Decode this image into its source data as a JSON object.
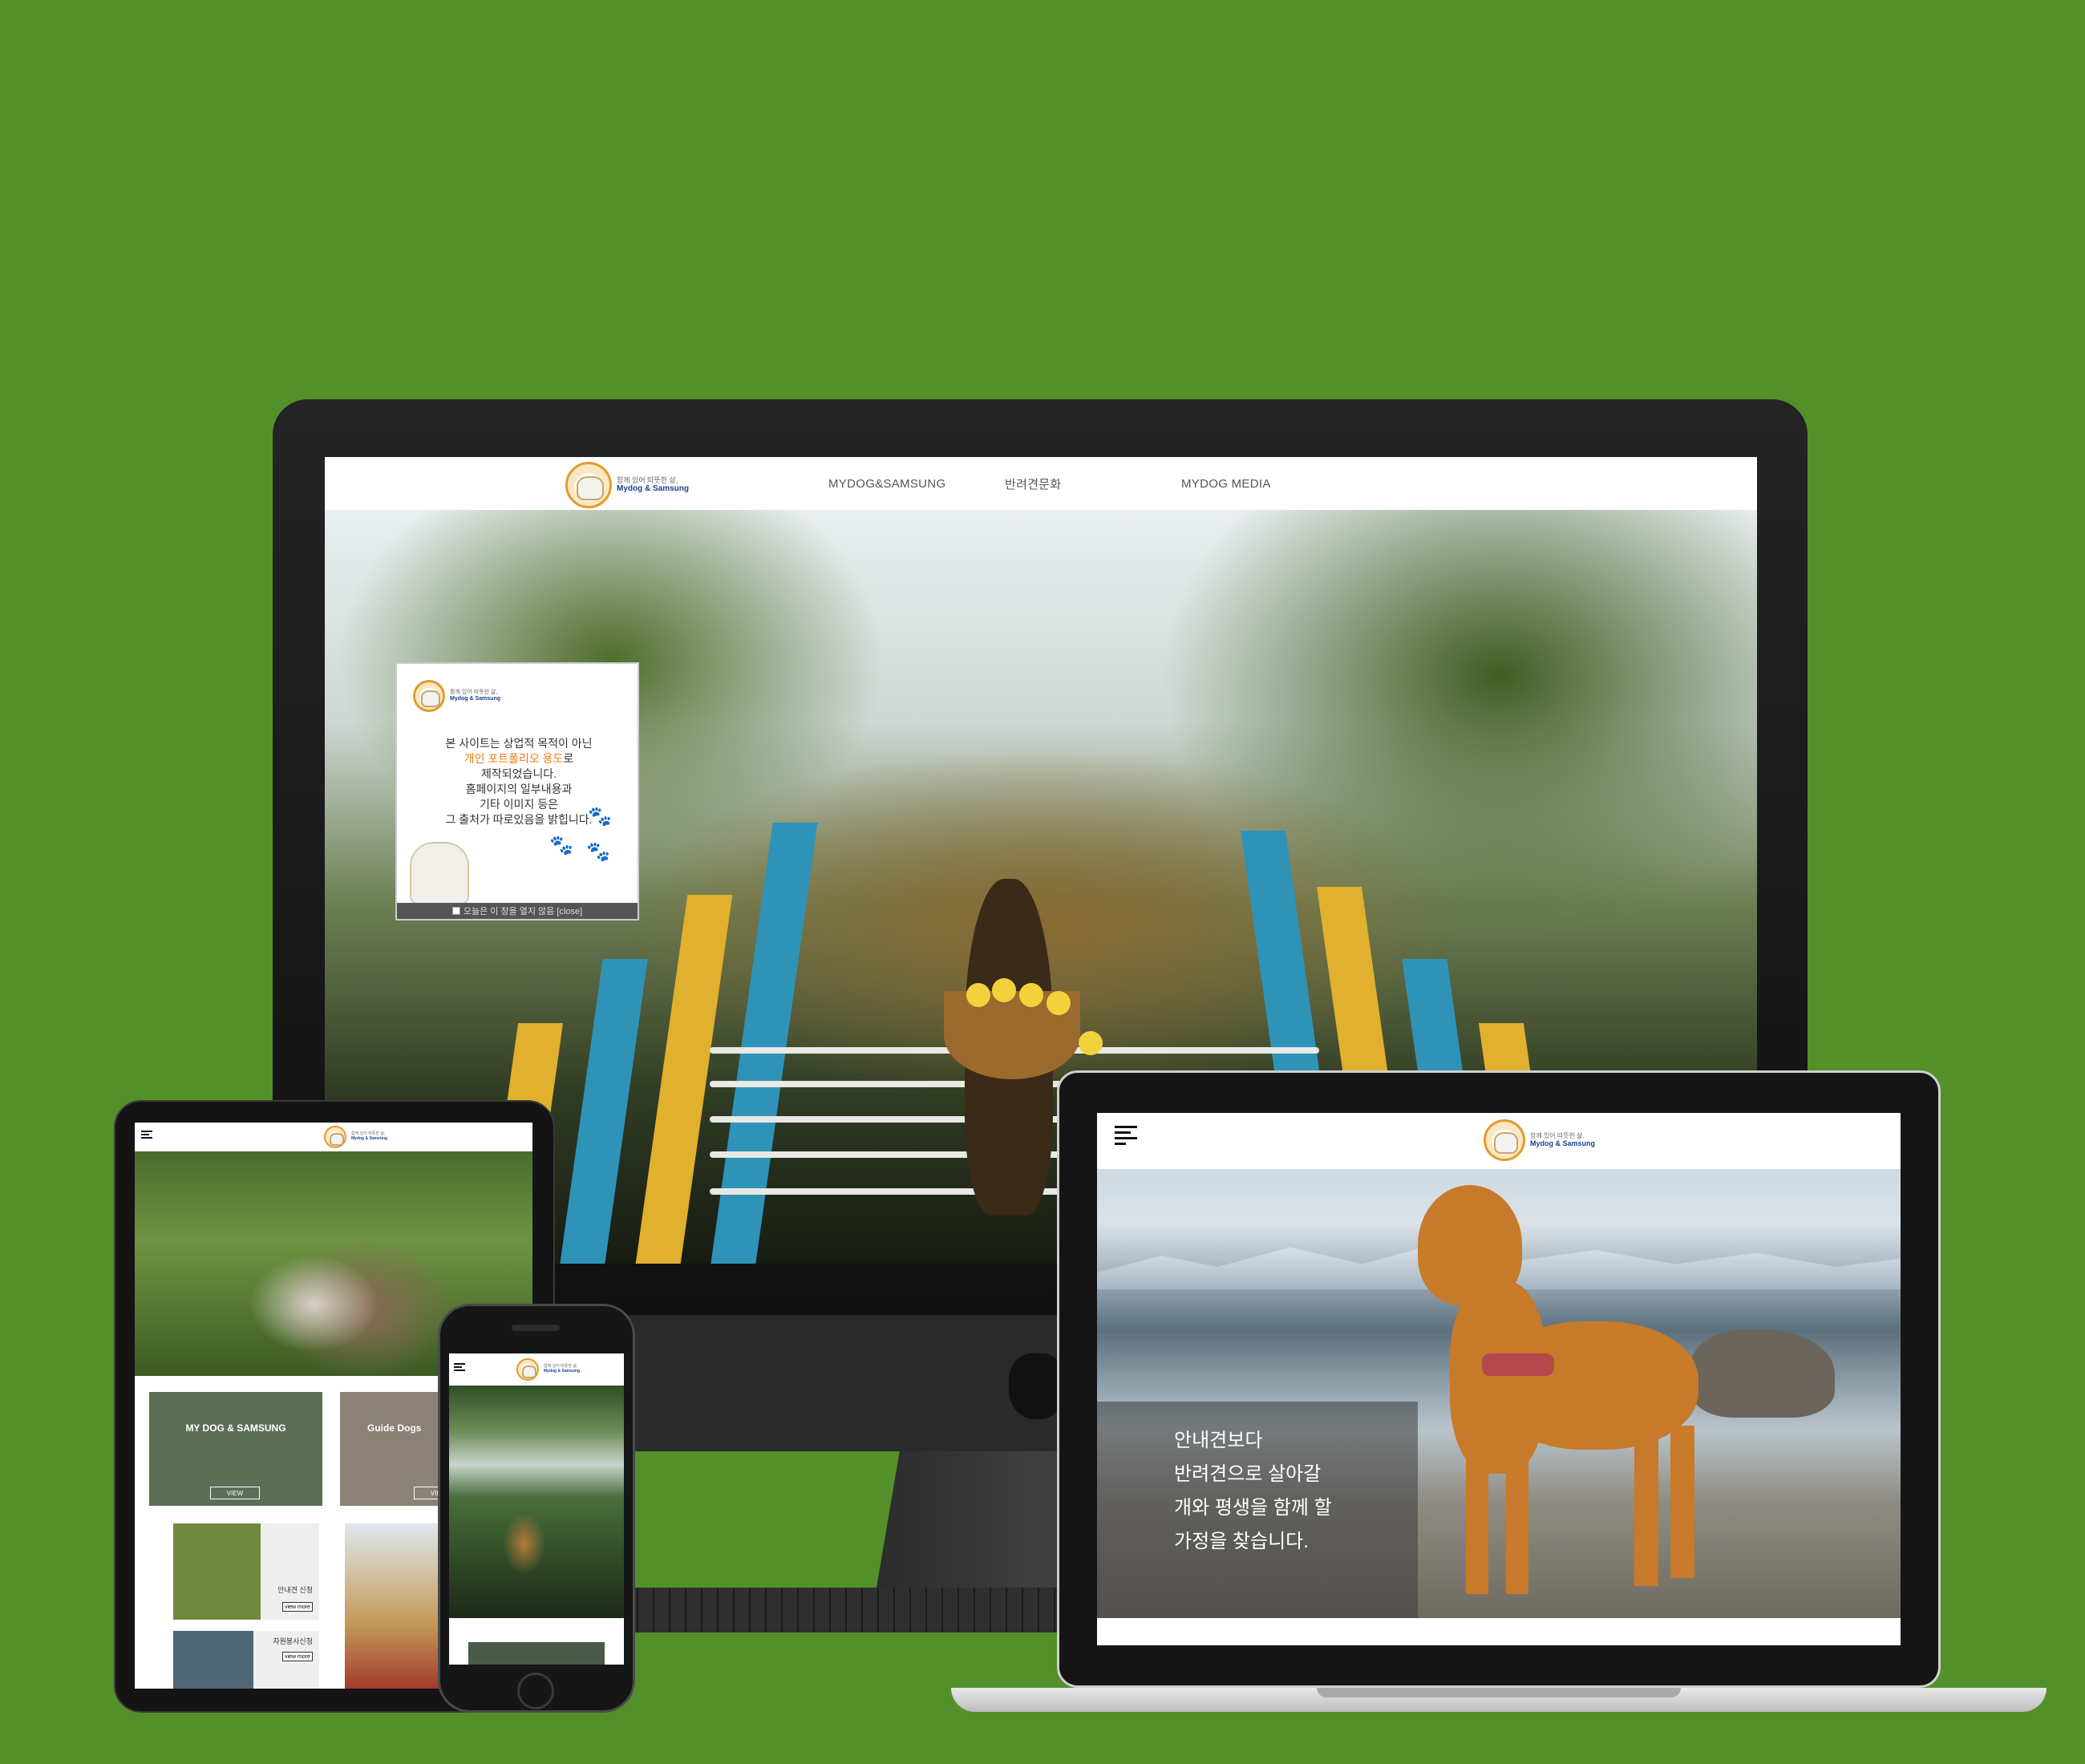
{
  "colors": {
    "background": "#53902a",
    "accent": "#ef7d12",
    "brand": "#1b3f8f"
  },
  "brand": {
    "tagline": "함께 있어 따뜻한 삶,",
    "name": "Mydog & Samsung"
  },
  "desktop": {
    "nav": [
      "MYDOG&SAMSUNG",
      "반려견문화",
      "MYDOG MEDIA"
    ],
    "popup": {
      "line1": "본 사이트는 상업적 목적이 아닌",
      "line2_highlight": "개인 포트폴리오 용도",
      "line2_suffix": "로",
      "line3": "제작되었습니다.",
      "line4": "홈페이지의 일부내용과",
      "line5": "기타 이미지 등은",
      "line6": "그 출처가 따로있음을 밝힙니다.",
      "footer": "오늘은 이 창을 열지 않음 [close]"
    }
  },
  "laptop": {
    "caption": [
      "안내견보다",
      "반려견으로 살아갈",
      "개와 평생을 함께 할",
      "가정을 찾습니다."
    ]
  },
  "tablet": {
    "cards": [
      {
        "title": "MY DOG & SAMSUNG",
        "button": "VIEW"
      },
      {
        "title": "Guide Dogs",
        "button": "VIEW"
      }
    ],
    "mini_cards": [
      {
        "label": "안내견 신청",
        "button": "view more"
      },
      {
        "label": "자원봉사신청",
        "button": "view more"
      }
    ]
  },
  "icons": [
    "menu-icon",
    "paw-icon",
    "apple-icon",
    "logo-icon"
  ]
}
